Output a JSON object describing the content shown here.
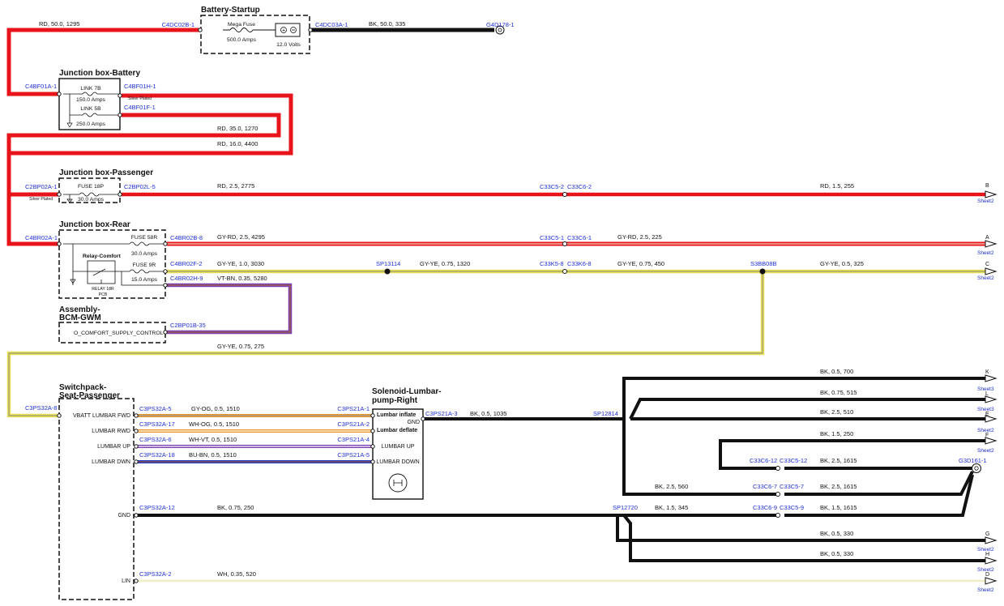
{
  "blocks": {
    "battery_startup": "Battery-Startup",
    "jb_battery": "Junction box-Battery",
    "jb_passenger": "Junction box-Passenger",
    "jb_rear": "Junction box-Rear",
    "bcm_1": "Assembly-",
    "bcm_2": "BCM-GWM",
    "switchpack_1": "Switchpack-",
    "switchpack_2": "Seat-Passenger",
    "solenoid_1": "Solenoid-Lumbar-",
    "solenoid_2": "pump-Right"
  },
  "components": {
    "mega_fuse": "Mega Fuse",
    "mega_fuse_rating": "500.0 Amps",
    "battery_voltage": "12.0 Volts",
    "link7b": "LINK 7B",
    "link7b_rating": "150.0 Amps",
    "link5b": "LINK 5B",
    "link5b_rating": "250.0 Amps",
    "silver_plated": "Silver Plated",
    "fuse18p": "FUSE 18P",
    "fuse18p_rating": "30.0 Amps",
    "fuse58r": "FUSE 58R",
    "fuse58r_rating": "30.0 Amps",
    "fuse9r": "FUSE 9R",
    "fuse9r_rating": "15.0 Amps",
    "relay_comfort": "Relay-Comfort",
    "relay_label_1": "RELAY 18R",
    "relay_label_2": "PCB",
    "bcm_signal": "O_COMFORT_SUPPLY_CONTROL"
  },
  "connectors": {
    "c4dc02b": "C4DC02B-1",
    "c4dc03a": "C4DC03A-1",
    "g4d178": "G4D178-1",
    "c4bf01a": "C4BF01A-1",
    "c4bf01h": "C4BF01H-1",
    "c4bf01f": "C4BF01F-1",
    "c2bp02a": "C2BP02A-1",
    "c2bp02l": "C2BP02L-5",
    "c33c5_2": "C33C5-2",
    "c33c6_2": "C33C6-2",
    "c4br02a": "C4BR02A-1",
    "c4br02b": "C4BR02B-8",
    "c33c5_1": "C33C5-1",
    "c33c6_1": "C33C6-1",
    "c4br02f": "C4BR02F-2",
    "sp13114": "SP13114",
    "c33k5_8": "C33K5-8",
    "c33k6_8": "C33K6-8",
    "s3bb08b": "S3BB08B",
    "c4br02h": "C4BR02H-9",
    "c2bp01b": "C2BP01B-35",
    "c3ps32a_8": "C3PS32A-8",
    "c3ps32a_5": "C3PS32A-5",
    "c3ps32a_17": "C3PS32A-17",
    "c3ps32a_6": "C3PS32A-6",
    "c3ps32a_18": "C3PS32A-18",
    "c3ps32a_12": "C3PS32A-12",
    "c3ps32a_2": "C3PS32A-2",
    "c3ps21a_1": "C3PS21A-1",
    "c3ps21a_2": "C3PS21A-2",
    "c3ps21a_4": "C3PS21A-4",
    "c3ps21a_5": "C3PS21A-5",
    "c3ps21a_3": "C3PS21A-3",
    "sp12814": "SP12814",
    "sp12720": "SP12720",
    "c33c6_12": "C33C6-12",
    "c33c5_12": "C33C5-12",
    "c33c6_7": "C33C6-7",
    "c33c5_7": "C33C5-7",
    "c33c6_9": "C33C6-9",
    "c33c5_9": "C33C5-9",
    "g3d161": "G3D161-1"
  },
  "wires": {
    "w_rd_50_1295": "RD, 50.0, 1295",
    "w_bk_50_335": "BK, 50.0, 335",
    "w_rd_35_1270": "RD, 35.0, 1270",
    "w_rd_16_4400": "RD, 16.0, 4400",
    "w_rd_25_2775": "RD, 2.5, 2775",
    "w_rd_15_255": "RD, 1.5, 255",
    "w_gyrd_25_4295": "GY-RD, 2.5, 4295",
    "w_gyrd_25_225": "GY-RD, 2.5, 225",
    "w_gyye_10_3030": "GY-YE, 1.0, 3030",
    "w_gyye_075_1320": "GY-YE, 0.75, 1320",
    "w_gyye_075_450": "GY-YE, 0.75, 450",
    "w_gyye_05_325": "GY-YE, 0.5, 325",
    "w_vtbn_035_5280": "VT-BN, 0.35, 5280",
    "w_gyye_075_275": "GY-YE, 0.75, 275",
    "w_gyog": "GY-OG, 0.5, 1510",
    "w_whog": "WH-OG, 0.5, 1510",
    "w_whvt": "WH-VT, 0.5, 1510",
    "w_bubn": "BU-BN, 0.5, 1510",
    "w_bk_05_1035": "BK, 0.5, 1035",
    "w_bk_075_250": "BK, 0.75, 250",
    "w_bk_15_345": "BK, 1.5, 345",
    "w_wh_035_520": "WH, 0.35, 520",
    "w_bk_05_700": "BK, 0.5, 700",
    "w_bk_075_515": "BK, 0.75, 515",
    "w_bk_25_510": "BK, 2.5, 510",
    "w_bk_15_250": "BK, 1.5, 250",
    "w_bk_25_1615a": "BK, 2.5, 1615",
    "w_bk_25_560": "BK, 2.5, 560",
    "w_bk_25_1615b": "BK, 2.5, 1615",
    "w_bk_15_1615": "BK, 1.5, 1615",
    "w_bk_05_330a": "BK, 0.5, 330",
    "w_bk_05_330b": "BK, 0.5, 330"
  },
  "pins": {
    "vbatt": "VBATT",
    "lumbar_fwd": "LUMBAR FWD",
    "lumbar_rwd": "LUMBAR RWD",
    "lumbar_up": "LUMBAR UP",
    "lumbar_dwn": "LUMBAR DWN",
    "gnd": "GND",
    "lin": "LIN",
    "sol_inflate": "Lumbar inflate",
    "sol_gnd": "GND",
    "sol_deflate": "Lumbar deflate",
    "sol_up": "LUMBAR UP",
    "sol_down": "LUMBAR DOWN"
  },
  "sheet_refs": {
    "b": "B",
    "a": "A",
    "c": "C",
    "k": "K",
    "l": "L",
    "e": "E",
    "f": "F",
    "g": "G",
    "h": "H",
    "d": "D",
    "sheet2": "Sheet2",
    "sheet3": "Sheet3"
  },
  "colors": {
    "red": "#e8141b",
    "black": "#111111",
    "yellow": "#e9e05a",
    "orange": "#e8962a",
    "purple": "#7b3fb0",
    "blue_text": "#1f2fd6"
  }
}
